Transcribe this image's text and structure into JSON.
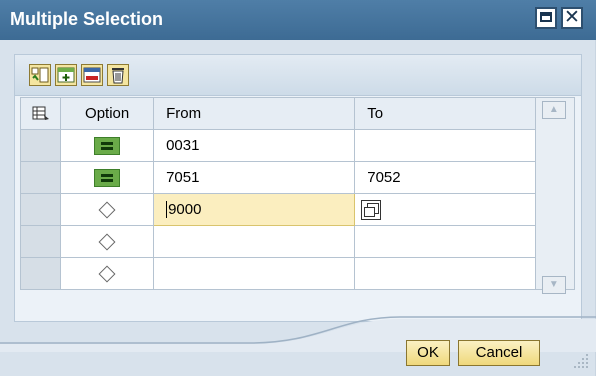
{
  "window": {
    "title": "Multiple Selection"
  },
  "table": {
    "headers": {
      "option": "Option",
      "from": "From",
      "to": "To"
    },
    "rows": [
      {
        "option": "equals",
        "from": "0031",
        "to": ""
      },
      {
        "option": "equals",
        "from": "7051",
        "to": "7052"
      },
      {
        "option": "empty",
        "from": "9000",
        "to": ""
      },
      {
        "option": "empty",
        "from": "",
        "to": ""
      },
      {
        "option": "empty",
        "from": "",
        "to": ""
      }
    ]
  },
  "buttons": {
    "ok": "OK",
    "cancel": "Cancel"
  },
  "colors": {
    "titlebar": "#4679a3",
    "accent_button": "#f4e5a0",
    "equals_icon": "#6aab49"
  }
}
